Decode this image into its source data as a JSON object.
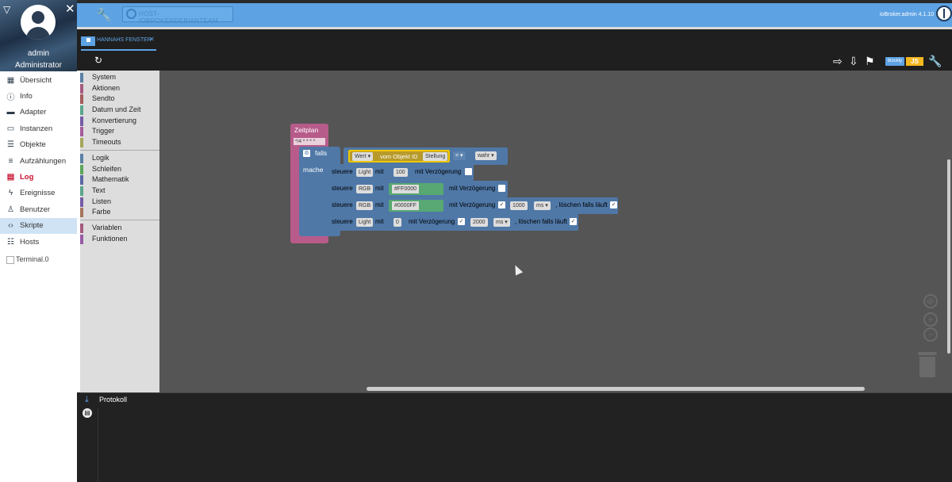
{
  "user": {
    "name": "admin",
    "role": "Administrator"
  },
  "sidebar": {
    "items": [
      {
        "label": "Übersicht",
        "icon": "apps-grid-icon"
      },
      {
        "label": "Info",
        "icon": "info-icon"
      },
      {
        "label": "Adapter",
        "icon": "store-icon"
      },
      {
        "label": "Instanzen",
        "icon": "instances-icon"
      },
      {
        "label": "Objekte",
        "icon": "list-icon"
      },
      {
        "label": "Aufzählungen",
        "icon": "enums-icon"
      },
      {
        "label": "Log",
        "icon": "log-icon"
      },
      {
        "label": "Ereignisse",
        "icon": "flash-icon"
      },
      {
        "label": "Benutzer",
        "icon": "person-icon"
      },
      {
        "label": "Skripte",
        "icon": "code-icon"
      },
      {
        "label": "Hosts",
        "icon": "hosts-icon"
      }
    ],
    "terminal": "Terminal.0"
  },
  "topbar": {
    "host_button": "HOST-IOBROKERDEBIANTEAM",
    "version": "ioBroker.admin 4.1.10"
  },
  "editor": {
    "tab_label": "HANNAHS FENSTER",
    "blockly_tag": "blockly",
    "js_tag": "JS"
  },
  "toolbox": {
    "group1": [
      "System",
      "Aktionen",
      "Sendto",
      "Datum und Zeit",
      "Konvertierung",
      "Trigger",
      "Timeouts"
    ],
    "group2": [
      "Logik",
      "Schleifen",
      "Mathematik",
      "Text",
      "Listen",
      "Farbe"
    ],
    "group3": [
      "Variablen",
      "Funktionen"
    ]
  },
  "blocks": {
    "schedule": {
      "label": "Zeitplan",
      "cron": "*/4 * * * *"
    },
    "if": {
      "falls": "falls",
      "mache": "mache"
    },
    "condition": {
      "field": "Wert",
      "of_object": "vom Objekt ID",
      "object": "Stellung",
      "op": "=",
      "value": "wahr"
    },
    "row1": {
      "steuere": "steuere",
      "target": "Light",
      "mit": "mit",
      "value": "100",
      "delay": "mit Verzögerung"
    },
    "row2": {
      "steuere": "steuere",
      "target": "RGB",
      "mit": "mit",
      "value": "#FF0000",
      "delay": "mit Verzögerung"
    },
    "row3": {
      "steuere": "steuere",
      "target": "RGB",
      "mit": "mit",
      "value": "#0000FF",
      "delay": "mit Verzögerung",
      "time": "1000",
      "unit": "ms",
      "clear": ", löschen falls läuft"
    },
    "row4": {
      "steuere": "steuere",
      "target": "Light",
      "mit": "mit",
      "value": "0",
      "delay": "mit Verzögerung",
      "time": "2000",
      "unit": "ms",
      "clear": ", löschen falls läuft"
    }
  },
  "log": {
    "title": "Protokoll"
  }
}
